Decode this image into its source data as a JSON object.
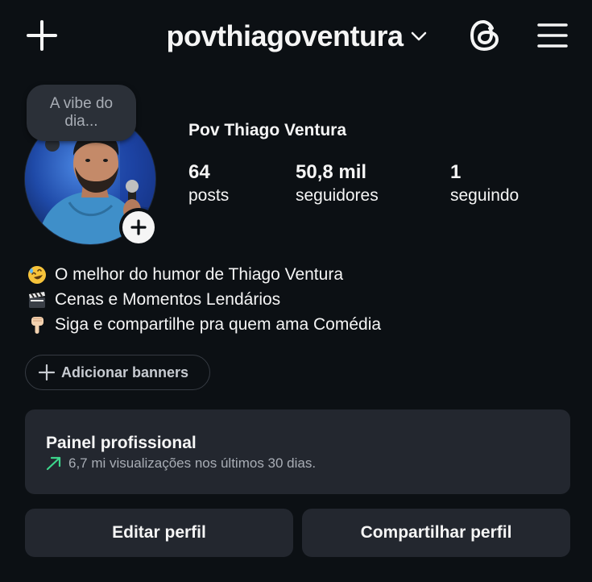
{
  "header": {
    "username": "povthiagoventura",
    "icons": {
      "create": "plus-icon",
      "account_switch": "chevron-down-icon",
      "threads": "threads-icon",
      "menu": "hamburger-menu-icon"
    }
  },
  "note": {
    "text": "A vibe do dia..."
  },
  "profile": {
    "display_name": "Pov Thiago Ventura",
    "stats": [
      {
        "value": "64",
        "label": "posts"
      },
      {
        "value": "50,8 mil",
        "label": "seguidores"
      },
      {
        "value": "1",
        "label": "seguindo"
      }
    ]
  },
  "bio": {
    "lines": [
      {
        "emoji": "rolling-on-floor-laughing",
        "text": "O melhor do humor de Thiago Ventura"
      },
      {
        "emoji": "clapper-board",
        "text": "Cenas e Momentos Lendários"
      },
      {
        "emoji": "backhand-index-pointing-down",
        "text": "Siga e compartilhe pra quem ama Comédia"
      }
    ]
  },
  "banners": {
    "label": "Adicionar banners"
  },
  "professional_dashboard": {
    "title": "Painel profissional",
    "subtitle": "6,7 mi visualizações nos últimos 30 dias.",
    "trend_color": "#3dd68c"
  },
  "actions": {
    "edit_label": "Editar perfil",
    "share_label": "Compartilhar perfil"
  },
  "colors": {
    "background": "#0c1014",
    "surface": "#23272f",
    "text": "#f5f5f5",
    "muted": "#a8adb5"
  }
}
